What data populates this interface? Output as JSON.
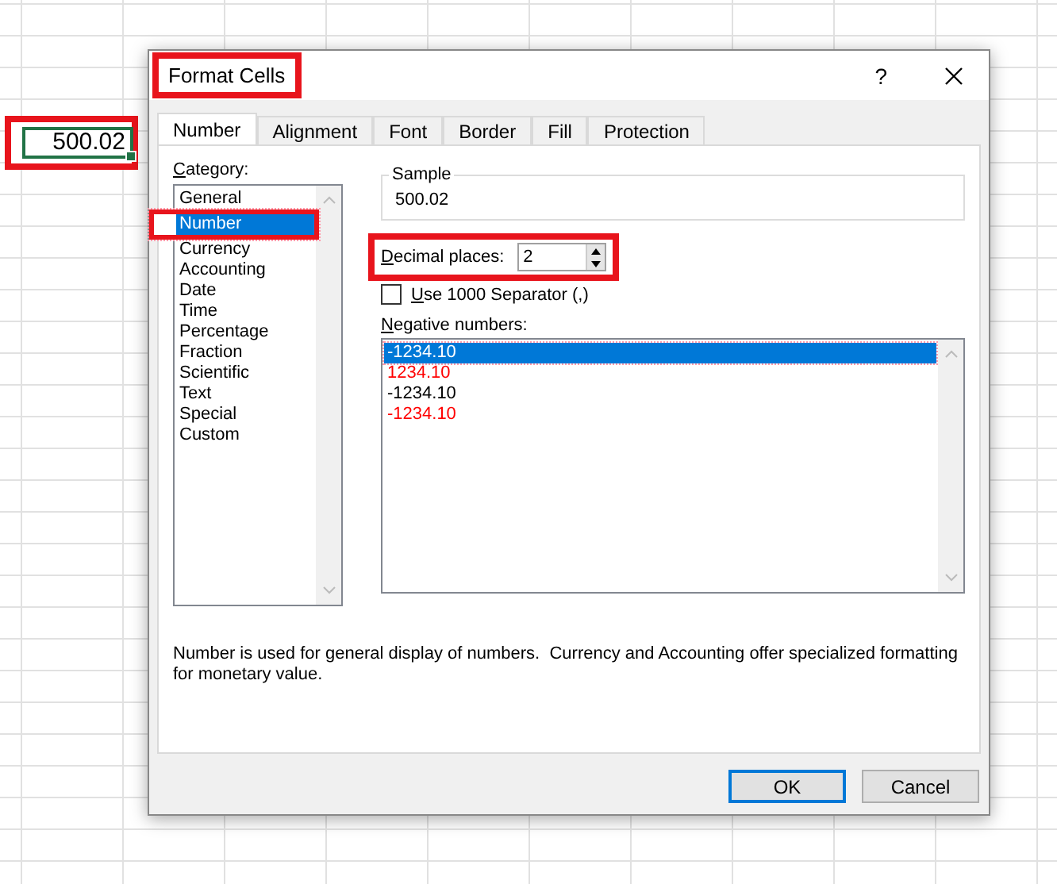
{
  "cell": {
    "value": "500.02",
    "highlighted": true
  },
  "window": {
    "title": "Format Cells",
    "title_highlighted": true,
    "help": "?"
  },
  "tabs": [
    {
      "label": "Number",
      "selected": true
    },
    {
      "label": "Alignment",
      "selected": false
    },
    {
      "label": "Font",
      "selected": false
    },
    {
      "label": "Border",
      "selected": false
    },
    {
      "label": "Fill",
      "selected": false
    },
    {
      "label": "Protection",
      "selected": false
    }
  ],
  "category": {
    "label": "Category:",
    "underline_first": true,
    "items": [
      {
        "label": "General",
        "selected": false,
        "highlighted": false
      },
      {
        "label": "Number",
        "selected": true,
        "highlighted": true
      },
      {
        "label": "Currency",
        "selected": false,
        "highlighted": false
      },
      {
        "label": "Accounting",
        "selected": false,
        "highlighted": false
      },
      {
        "label": "Date",
        "selected": false,
        "highlighted": false
      },
      {
        "label": "Time",
        "selected": false,
        "highlighted": false
      },
      {
        "label": "Percentage",
        "selected": false,
        "highlighted": false
      },
      {
        "label": "Fraction",
        "selected": false,
        "highlighted": false
      },
      {
        "label": "Scientific",
        "selected": false,
        "highlighted": false
      },
      {
        "label": "Text",
        "selected": false,
        "highlighted": false
      },
      {
        "label": "Special",
        "selected": false,
        "highlighted": false
      },
      {
        "label": "Custom",
        "selected": false,
        "highlighted": false
      }
    ]
  },
  "sample": {
    "label": "Sample",
    "value": "500.02"
  },
  "decimal_places": {
    "label": "Decimal places:",
    "underline_first": true,
    "value": "2",
    "highlighted": true
  },
  "separator": {
    "label": "Use 1000 Separator (,)",
    "underline_first": true,
    "checked": false
  },
  "negative_numbers": {
    "label": "Negative numbers:",
    "underline_first": true,
    "items": [
      {
        "label": "-1234.10",
        "selected": true
      },
      {
        "label": "1234.10",
        "selected": false,
        "color": "#ff0000"
      },
      {
        "label": "-1234.10",
        "selected": false,
        "color": "#000000"
      },
      {
        "label": "-1234.10",
        "selected": false,
        "color": "#ff0000"
      }
    ]
  },
  "description": "Number is used for general display of numbers.  Currency and Accounting offer specialized formatting for monetary value.",
  "buttons": [
    {
      "label": "OK",
      "default": true
    },
    {
      "label": "Cancel",
      "default": false
    }
  ]
}
